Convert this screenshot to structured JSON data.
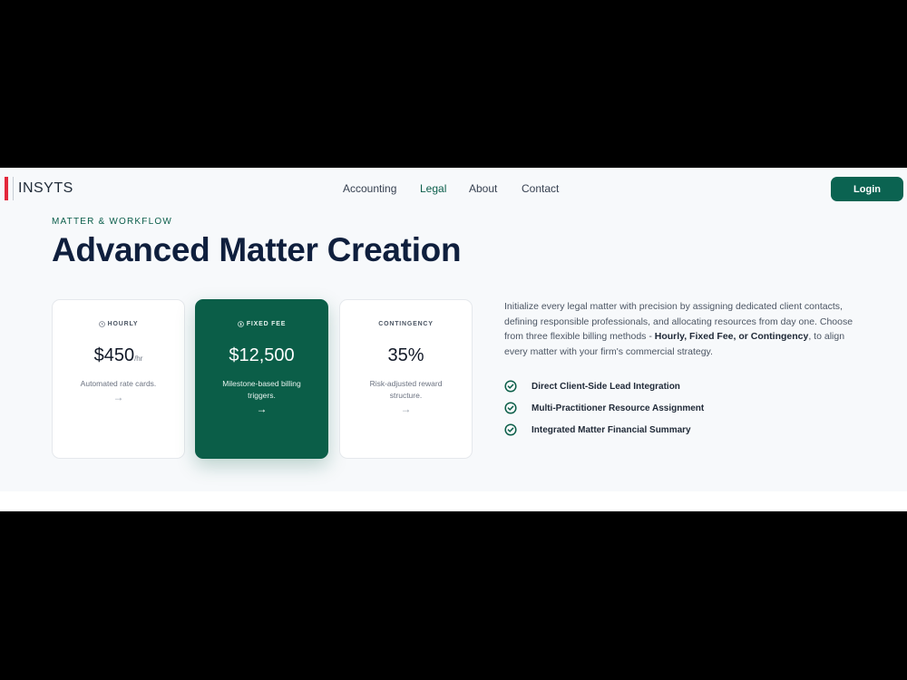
{
  "header": {
    "brand": "INSYTS",
    "nav": [
      {
        "label": "Accounting",
        "active": false
      },
      {
        "label": "Legal",
        "active": true
      },
      {
        "label": "About",
        "active": false
      },
      {
        "label": "Contact",
        "active": false
      }
    ],
    "login_label": "Login"
  },
  "hero": {
    "eyebrow": "MATTER & WORKFLOW",
    "title": "Advanced Matter Creation"
  },
  "cards": [
    {
      "label": "HOURLY",
      "icon": "clock-icon",
      "price": "$450",
      "unit": "/hr",
      "desc": "Automated rate cards.",
      "arrow": "→"
    },
    {
      "label": "FIXED FEE",
      "icon": "dollar-circle-icon",
      "price": "$12,500",
      "unit": "",
      "desc": "Milestone-based billing triggers.",
      "arrow": "→"
    },
    {
      "label": "CONTINGENCY",
      "icon": "",
      "price": "35%",
      "unit": "",
      "desc": "Risk-adjusted reward structure.",
      "arrow": "→"
    }
  ],
  "description": {
    "text_before": "Initialize every legal matter with precision by assigning dedicated client contacts, defining responsible professionals, and allocating resources from day one. Choose from three flexible billing methods - ",
    "text_bold": "Hourly, Fixed Fee, or Contingency",
    "text_after": ", to align every matter with your firm's commercial strategy."
  },
  "features": [
    "Direct Client-Side Lead Integration",
    "Multi-Practitioner Resource Assignment",
    "Integrated Matter Financial Summary"
  ],
  "colors": {
    "brand_green": "#0b5e48",
    "logo_red": "#e3283c",
    "title_navy": "#0f1f3d"
  }
}
